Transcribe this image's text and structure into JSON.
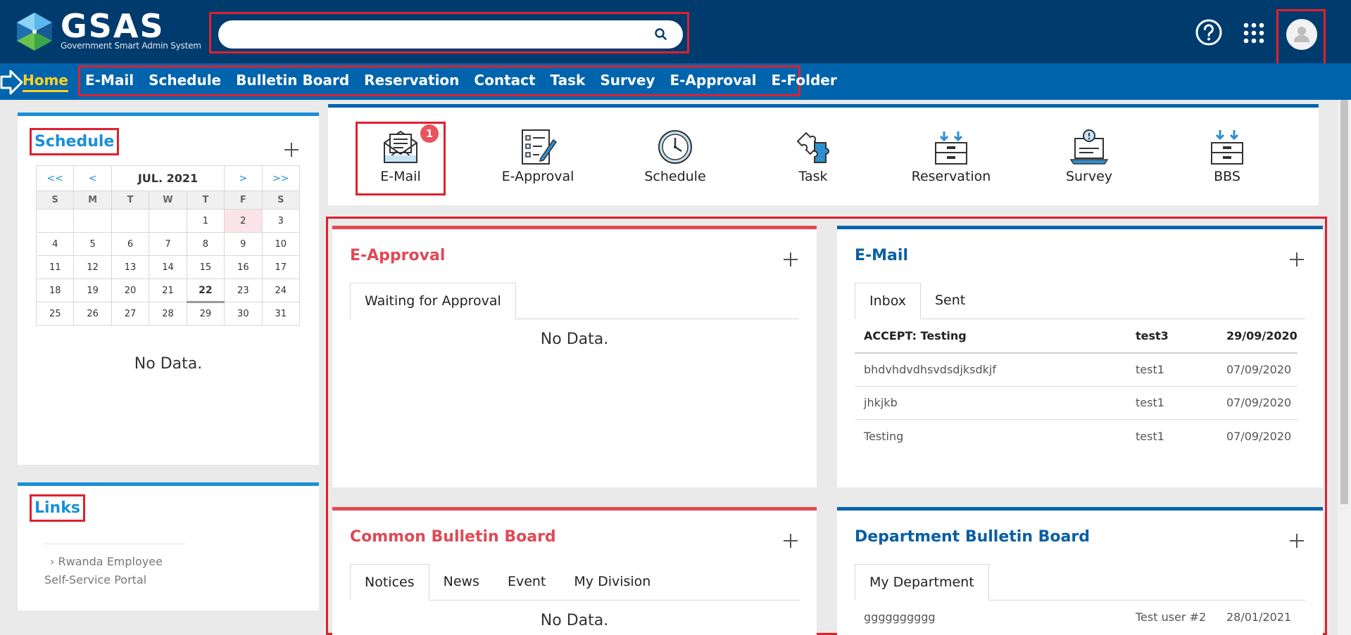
{
  "header": {
    "logo_text": "GSAS",
    "logo_subtitle": "Government Smart Admin System",
    "search": {
      "value": "",
      "placeholder": ""
    }
  },
  "nav": {
    "home_label": "Home",
    "items": [
      {
        "label": "E-Mail"
      },
      {
        "label": "Schedule"
      },
      {
        "label": "Bulletin Board"
      },
      {
        "label": "Reservation"
      },
      {
        "label": "Contact"
      },
      {
        "label": "Task"
      },
      {
        "label": "Survey"
      },
      {
        "label": "E-Approval"
      },
      {
        "label": "E-Folder"
      }
    ]
  },
  "schedule": {
    "title": "Schedule",
    "calendar": {
      "prev_year": "<<",
      "prev_month": "<",
      "month_label": "JUL. 2021",
      "next_month": ">",
      "next_year": ">>",
      "weekdays": [
        "S",
        "M",
        "T",
        "W",
        "T",
        "F",
        "S"
      ],
      "weeks": [
        [
          "",
          "",
          "",
          "",
          "1",
          "2",
          "3"
        ],
        [
          "4",
          "5",
          "6",
          "7",
          "8",
          "9",
          "10"
        ],
        [
          "11",
          "12",
          "13",
          "14",
          "15",
          "16",
          "17"
        ],
        [
          "18",
          "19",
          "20",
          "21",
          "22",
          "23",
          "24"
        ],
        [
          "25",
          "26",
          "27",
          "28",
          "29",
          "30",
          "31"
        ]
      ],
      "today": "22",
      "highlighted": "2"
    },
    "no_data": "No Data."
  },
  "links": {
    "title": "Links",
    "items": [
      {
        "line1": "Rwanda Employee",
        "line2": "Self-Service Portal"
      }
    ]
  },
  "quick_icons": [
    {
      "label": "E-Mail",
      "icon": "envelope-icon",
      "badge": "1"
    },
    {
      "label": "E-Approval",
      "icon": "checklist-icon"
    },
    {
      "label": "Schedule",
      "icon": "clock-icon"
    },
    {
      "label": "Task",
      "icon": "puzzle-icon"
    },
    {
      "label": "Reservation",
      "icon": "drawer-icon"
    },
    {
      "label": "Survey",
      "icon": "laptop-icon"
    },
    {
      "label": "BBS",
      "icon": "tray-icon"
    }
  ],
  "widgets": {
    "approval": {
      "title": "E-Approval",
      "tabs": [
        "Waiting for Approval"
      ],
      "no_data": "No Data."
    },
    "email": {
      "title": "E-Mail",
      "tabs": [
        "Inbox",
        "Sent"
      ],
      "rows": [
        {
          "subject": "ACCEPT: Testing",
          "from": "test3",
          "date": "29/09/2020"
        },
        {
          "subject": "bhdvhdvdhsvdsdjksdkjf",
          "from": "test1",
          "date": "07/09/2020"
        },
        {
          "subject": "jhkjkb",
          "from": "test1",
          "date": "07/09/2020"
        },
        {
          "subject": "Testing",
          "from": "test1",
          "date": "07/09/2020"
        }
      ]
    },
    "common_bbs": {
      "title": "Common Bulletin Board",
      "tabs": [
        "Notices",
        "News",
        "Event",
        "My Division"
      ],
      "no_data": "No Data."
    },
    "dept_bbs": {
      "title": "Department Bulletin Board",
      "tabs": [
        "My Department"
      ],
      "rows": [
        {
          "subject": "gggggggggg",
          "author": "Test user #2",
          "date": "28/01/2021"
        }
      ]
    }
  },
  "colors": {
    "header_bg": "#003b6d",
    "nav_bg": "#0064ad",
    "home_active": "#ffd21f",
    "accent_blue": "#1a8fd8",
    "accent_red": "#e04a55",
    "annotation_red": "#e0202d"
  }
}
